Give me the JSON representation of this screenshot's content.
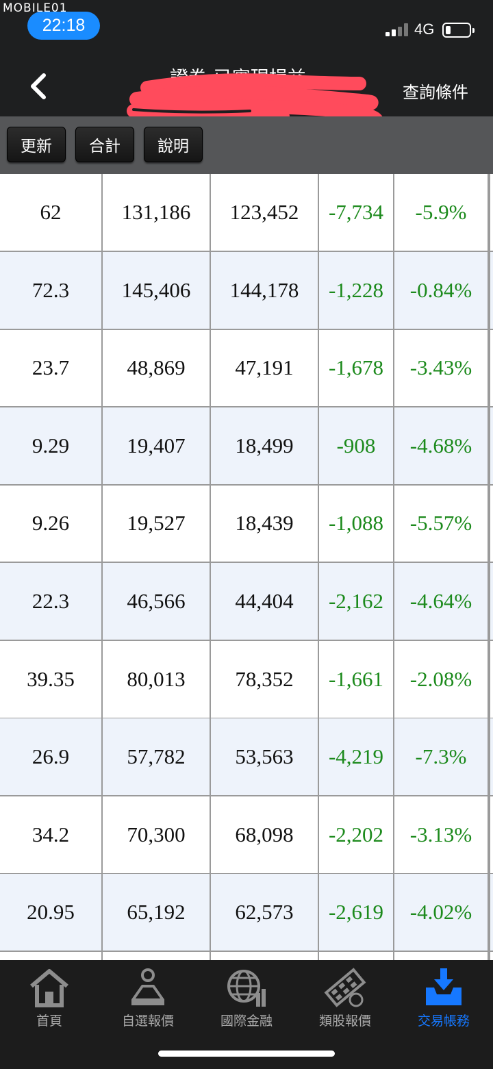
{
  "status_bar": {
    "watermark": "MOBILE01",
    "time": "22:18",
    "network": "4G"
  },
  "nav": {
    "title": "證券-已實現損益",
    "query_label": "查詢條件"
  },
  "toolbar": {
    "refresh_label": "更新",
    "total_label": "合計",
    "help_label": "說明"
  },
  "table": {
    "rows": [
      [
        "62",
        "131,186",
        "123,452",
        "-7,734",
        "-5.9%"
      ],
      [
        "72.3",
        "145,406",
        "144,178",
        "-1,228",
        "-0.84%"
      ],
      [
        "23.7",
        "48,869",
        "47,191",
        "-1,678",
        "-3.43%"
      ],
      [
        "9.29",
        "19,407",
        "18,499",
        "-908",
        "-4.68%"
      ],
      [
        "9.26",
        "19,527",
        "18,439",
        "-1,088",
        "-5.57%"
      ],
      [
        "22.3",
        "46,566",
        "44,404",
        "-2,162",
        "-4.64%"
      ],
      [
        "39.35",
        "80,013",
        "78,352",
        "-1,661",
        "-2.08%"
      ],
      [
        "26.9",
        "57,782",
        "53,563",
        "-4,219",
        "-7.3%"
      ],
      [
        "34.2",
        "70,300",
        "68,098",
        "-2,202",
        "-3.13%"
      ],
      [
        "20.95",
        "65,192",
        "62,573",
        "-2,619",
        "-4.02%"
      ]
    ]
  },
  "tabbar": {
    "tabs": [
      {
        "label": "首頁",
        "icon": "home-icon"
      },
      {
        "label": "自選報價",
        "icon": "watchlist-icon"
      },
      {
        "label": "國際金融",
        "icon": "globe-icon"
      },
      {
        "label": "類股報價",
        "icon": "sector-film-icon"
      },
      {
        "label": "交易帳務",
        "icon": "download-tray-icon",
        "active": true
      }
    ]
  },
  "colors": {
    "header_bg": "#1e1f20",
    "toolbar_bg": "#555658",
    "negative_green": "#1c8a1c",
    "accent_blue": "#1678ff",
    "alt_row_bg": "#eef3fb"
  }
}
